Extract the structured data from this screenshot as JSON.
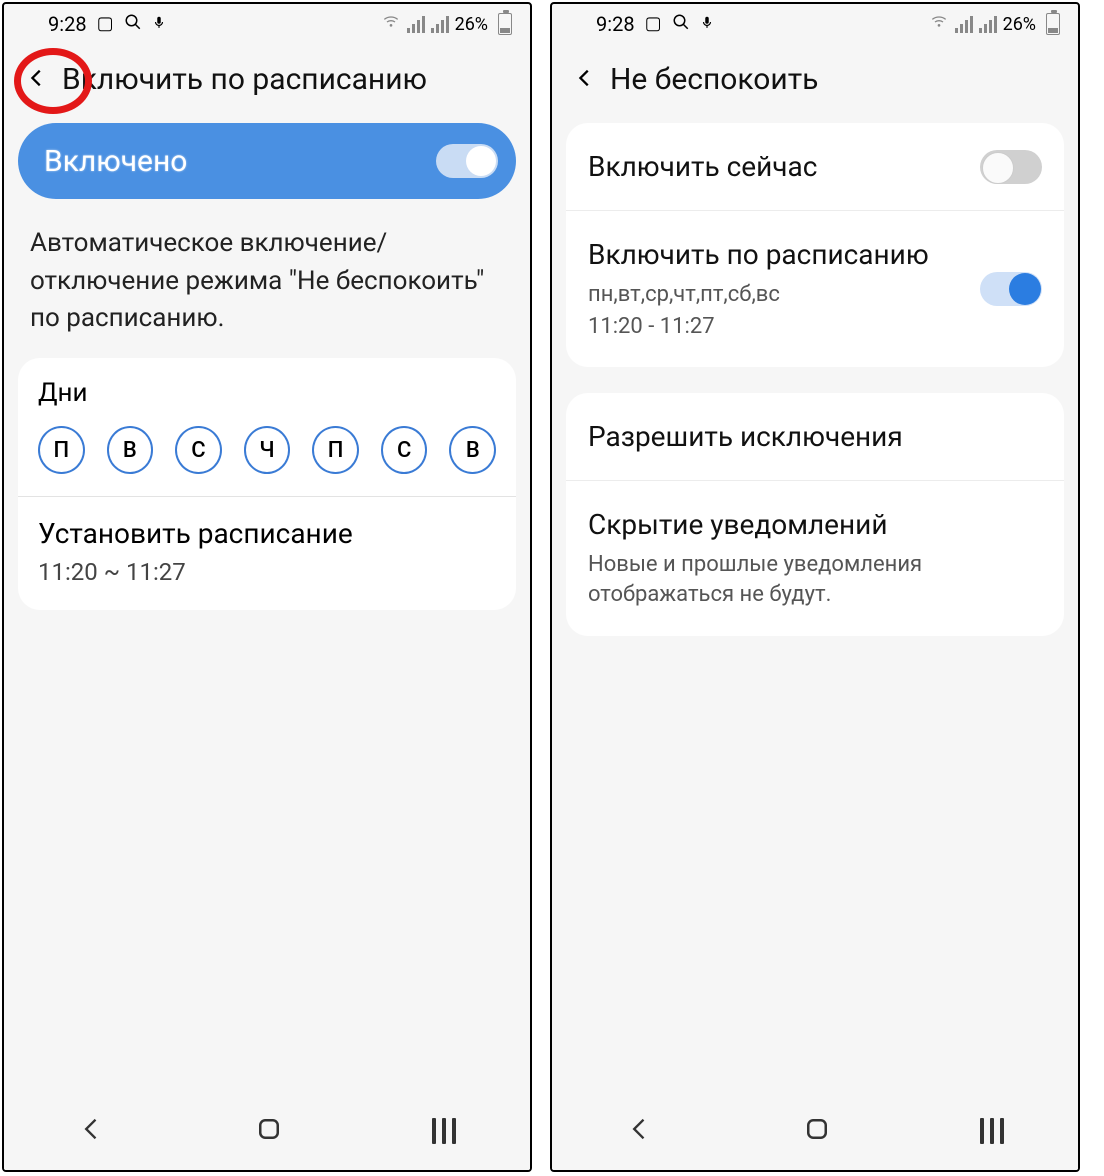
{
  "statusbar": {
    "time": "9:28",
    "battery_pct": "26%"
  },
  "screen1": {
    "header_title": "Включить по расписанию",
    "enabled_label": "Включено",
    "description": "Автоматическое включение/отключение режима \"Не беспокоить\" по расписанию.",
    "days_label": "Дни",
    "days": [
      "П",
      "В",
      "С",
      "Ч",
      "П",
      "С",
      "В"
    ],
    "schedule_title": "Установить расписание",
    "schedule_time": "11:20 ~ 11:27"
  },
  "screen2": {
    "header_title": "Не беспокоить",
    "row_now": "Включить сейчас",
    "row_sched_title": "Включить по расписанию",
    "row_sched_days": "пн,вт,ср,чт,пт,сб,вс",
    "row_sched_time": "11:20 - 11:27",
    "row_exceptions": "Разрешить исключения",
    "row_hide_title": "Скрытие уведомлений",
    "row_hide_sub": "Новые и прошлые уведомления отображаться не будут."
  }
}
